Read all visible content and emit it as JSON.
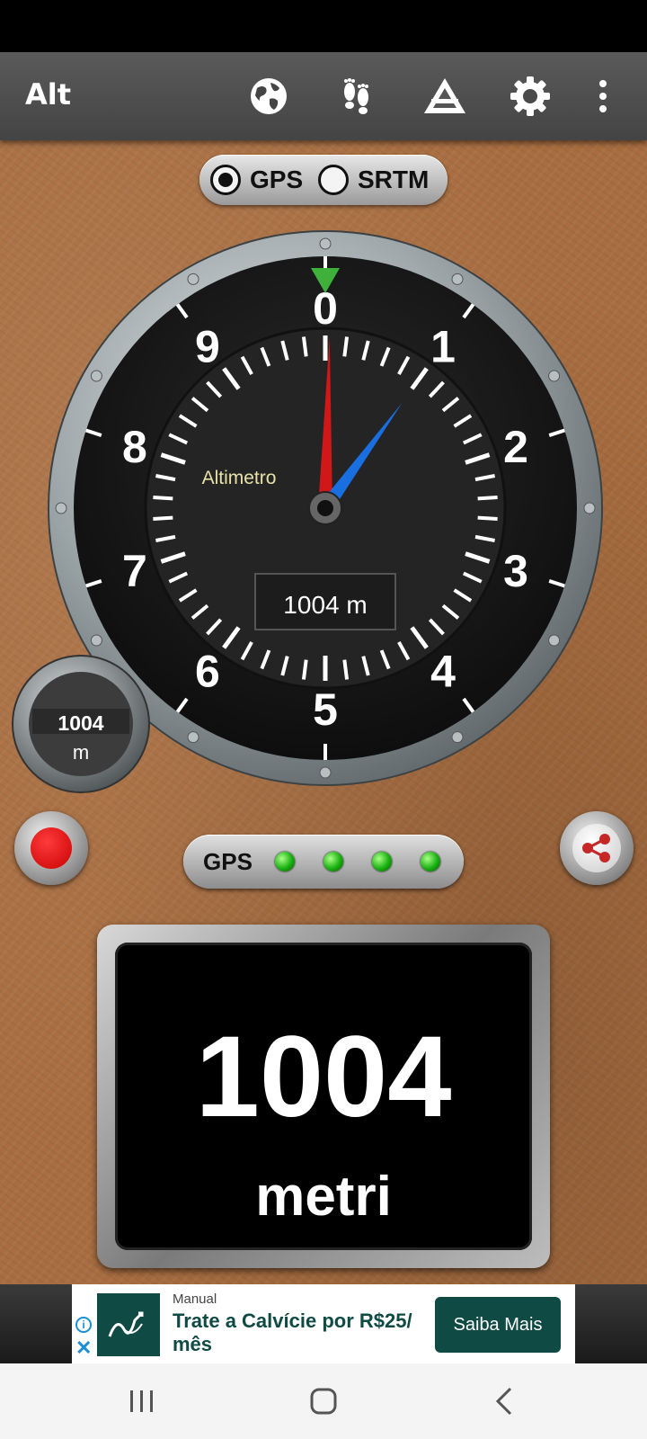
{
  "app": {
    "title": "Alt"
  },
  "toolbar": {
    "icons": [
      "globe-icon",
      "footprints-icon",
      "triangle-icon",
      "gear-icon",
      "more-vert-icon"
    ]
  },
  "source_toggle": {
    "options": [
      "GPS",
      "SRTM"
    ],
    "selected": "GPS"
  },
  "altimeter": {
    "label": "Altimetro",
    "readout": "1004 m",
    "dial_numbers": [
      "0",
      "1",
      "2",
      "3",
      "4",
      "5",
      "6",
      "7",
      "8",
      "9"
    ],
    "hundreds_hand_value": 0.04,
    "thousands_hand_value": 1.004,
    "hand_colors": {
      "long": "#1a6fe0",
      "short": "#d01818"
    }
  },
  "mini_gauge": {
    "value": "1004",
    "unit": "m"
  },
  "gps_signal": {
    "label": "GPS",
    "leds_on": 4,
    "led_color": "#1ec41a"
  },
  "display": {
    "value": "1004",
    "unit": "metri"
  },
  "ad": {
    "brand": "Manual",
    "text": "Trate a Calvície por R$25/ mês",
    "cta": "Saiba Mais",
    "accent": "#0f4b44"
  },
  "colors": {
    "leather": "#a86d40",
    "record": "#d00000"
  }
}
